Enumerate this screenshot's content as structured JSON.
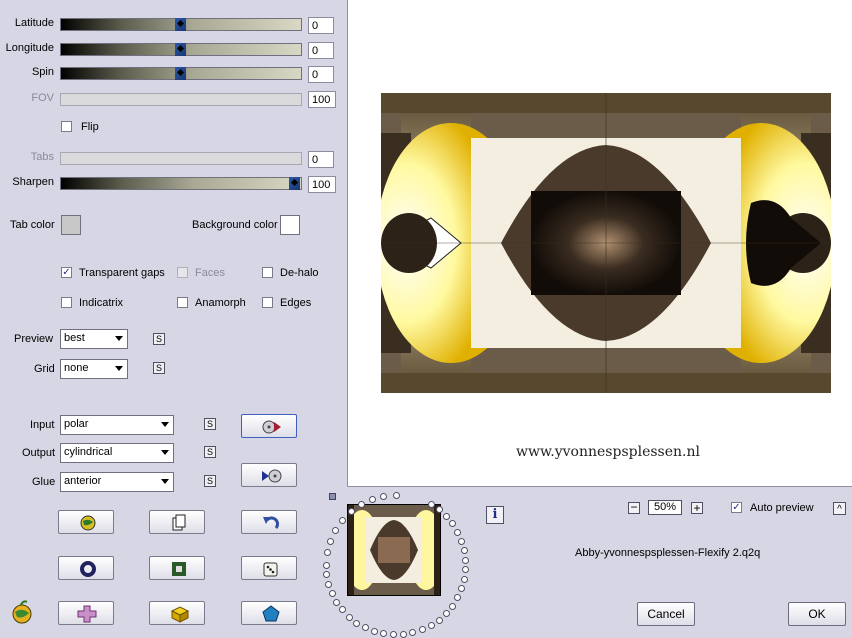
{
  "sliders": [
    {
      "label": "Latitude",
      "value": "0",
      "thumb_pct": 50,
      "disabled": false
    },
    {
      "label": "Longitude",
      "value": "0",
      "thumb_pct": 50,
      "disabled": false
    },
    {
      "label": "Spin",
      "value": "0",
      "thumb_pct": 50,
      "disabled": false
    },
    {
      "label": "FOV",
      "value": "100",
      "disabled": true
    },
    {
      "label": "Tabs",
      "value": "0",
      "disabled": true
    },
    {
      "label": "Sharpen",
      "value": "100",
      "thumb_pct": 100,
      "disabled": false
    }
  ],
  "flip_label": "Flip",
  "tab_color": {
    "label": "Tab color",
    "value": "#c8c8c8"
  },
  "background_color": {
    "label": "Background color",
    "value": "#ffffff"
  },
  "options": {
    "transparent_gaps": {
      "label": "Transparent gaps",
      "checked": true
    },
    "faces": {
      "label": "Faces",
      "checked": false,
      "disabled": true
    },
    "de_halo": {
      "label": "De-halo",
      "checked": false
    },
    "indicatrix": {
      "label": "Indicatrix",
      "checked": false
    },
    "anamorph": {
      "label": "Anamorph",
      "checked": false
    },
    "edges": {
      "label": "Edges",
      "checked": false
    }
  },
  "preview_select": {
    "label": "Preview",
    "value": "best"
  },
  "grid_select": {
    "label": "Grid",
    "value": "none"
  },
  "input_select": {
    "label": "Input",
    "value": "polar"
  },
  "output_select": {
    "label": "Output",
    "value": "cylindrical"
  },
  "glue_select": {
    "label": "Glue",
    "value": "anterior"
  },
  "s_label": "S",
  "zoom": {
    "value": "50%",
    "minus": "−",
    "plus": "+"
  },
  "auto_preview": {
    "label": "Auto preview",
    "checked": true
  },
  "preset_name": "Abby-yvonnespsplessen-Flexify 2.q2q",
  "watermark": "www.yvonnespsplessen.nl",
  "cancel_label": "Cancel",
  "ok_label": "OK",
  "info_glyph": "i",
  "collapse_glyph": "^"
}
